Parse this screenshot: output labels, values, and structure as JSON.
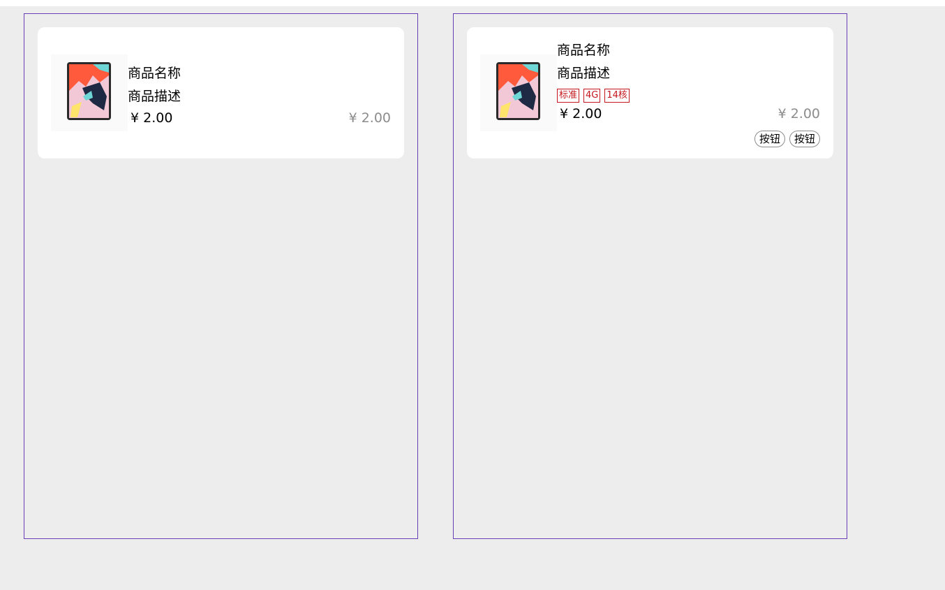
{
  "cards": [
    {
      "name": "商品名称",
      "description": "商品描述",
      "price": "¥ 2.00",
      "original_price": "¥ 2.00"
    },
    {
      "name": "商品名称",
      "description": "商品描述",
      "tags": [
        "标准",
        "4G",
        "14核"
      ],
      "price": "¥ 2.00",
      "original_price": "¥ 2.00",
      "buttons": [
        "按钮",
        "按钮"
      ]
    }
  ],
  "colors": {
    "background": "#ededed",
    "card": "#ffffff",
    "frame_border": "#6a3fb5",
    "tag": "#c4161c",
    "muted_price": "#8c8c8c"
  },
  "icons": {
    "product_image": "tablet-product-image"
  }
}
